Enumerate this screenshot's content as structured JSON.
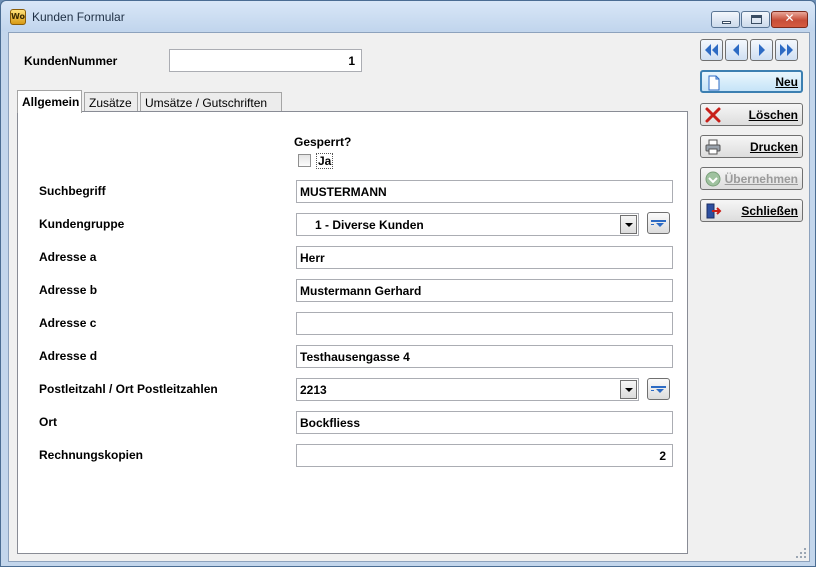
{
  "window": {
    "title": "Kunden Formular",
    "icon_text": "Wo",
    "close_glyph": "✕"
  },
  "header": {
    "kundennummer_label": "KundenNummer",
    "kundennummer_value": "1"
  },
  "tabs": [
    {
      "label": "Allgemein",
      "active": true
    },
    {
      "label": "Zusätze",
      "active": false
    },
    {
      "label": "Umsätze / Gutschriften",
      "active": false
    }
  ],
  "form": {
    "gesperrt_label": "Gesperrt?",
    "gesperrt_checkbox_label": "Ja",
    "gesperrt_checked": false,
    "suchbegriff_label": "Suchbegriff",
    "suchbegriff_value": "MUSTERMANN",
    "kundengruppe_label": "Kundengruppe",
    "kundengruppe_value": "1 - Diverse Kunden",
    "adresse_a_label": "Adresse a",
    "adresse_a_value": "Herr",
    "adresse_b_label": "Adresse b",
    "adresse_b_value": "Mustermann Gerhard",
    "adresse_c_label": "Adresse c",
    "adresse_c_value": "",
    "adresse_d_label": "Adresse d",
    "adresse_d_value": "Testhausengasse 4",
    "plz_label": "Postleitzahl / Ort Postleitzahlen",
    "plz_value": "2213",
    "ort_label": "Ort",
    "ort_value": "Bockfliess",
    "rechnungskopien_label": "Rechnungskopien",
    "rechnungskopien_value": "2"
  },
  "navigation": [
    "first-record-icon",
    "previous-record-icon",
    "next-record-icon",
    "last-record-icon"
  ],
  "actions": {
    "neu": "Neu",
    "loeschen": "Löschen",
    "drucken": "Drucken",
    "uebernehmen": "Übernehmen",
    "schliessen": "Schließen"
  },
  "colors": {
    "focus_border": "#3c7fb1",
    "delete_red": "#c8201a",
    "nav_blue": "#2d6bc4"
  }
}
